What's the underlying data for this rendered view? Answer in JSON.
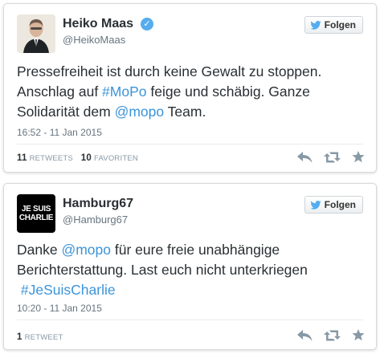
{
  "tweets": [
    {
      "name": "Heiko Maas",
      "handle": "@HeikoMaas",
      "follow_label": "Folgen",
      "verified": true,
      "text_line1": "Pressefreiheit ist durch keine Gewalt zu stoppen.",
      "text_line2_pre": "Anschlag auf ",
      "text_line2_link": "#MoPo",
      "text_line2_post": " feige und schäbig. Ganze",
      "text_line3_pre": "Solidarität dem ",
      "text_line3_link": "@mopo",
      "text_line3_post": " Team.",
      "date": "16:52 - 11 Jan 2015",
      "retweet_count": "11",
      "retweet_label": "RETWEETS",
      "favorite_count": "10",
      "favorite_label": "FAVORITEN"
    },
    {
      "name": "Hamburg67",
      "handle": "@Hamburg67",
      "follow_label": "Folgen",
      "avatar_line1": "JE SUIS",
      "avatar_line2": "CHARLIE",
      "text_line1_pre": "Danke ",
      "text_line1_link": "@mopo",
      "text_line1_post": " für eure freie unabhängige",
      "text_line2": "Berichterstattung. Last euch nicht unterkriegen",
      "text_line3_link": "#JeSuisCharlie",
      "date": "10:20 - 11 Jan 2015",
      "retweet_count": "1",
      "retweet_label": "RETWEET"
    }
  ],
  "colors": {
    "link": "#3b94d9",
    "verified": "#55acee",
    "muted": "#66757f",
    "bird": "#55acee"
  },
  "icons": [
    "twitter-bird-icon",
    "verified-badge-icon",
    "reply-icon",
    "retweet-icon",
    "favorite-star-icon"
  ]
}
